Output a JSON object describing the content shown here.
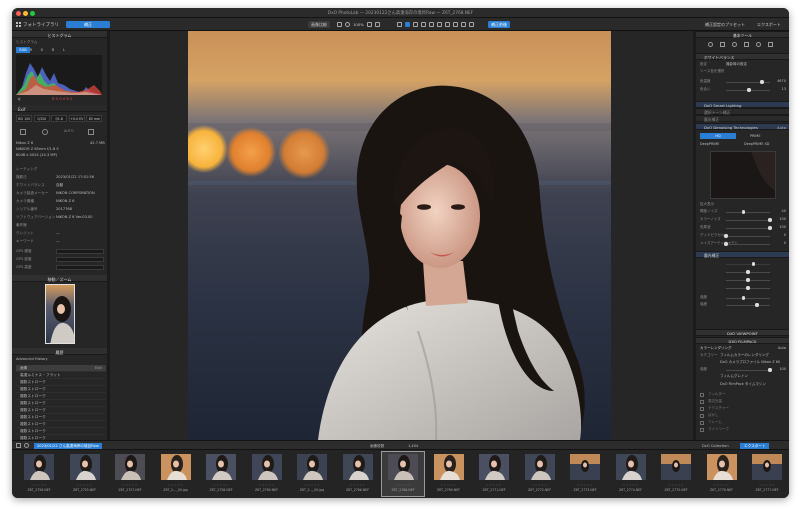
{
  "window": {
    "title": "DxO PhotoLab — 20230122さん高遠海岸の境目Raw — Z6T_2768.NEF"
  },
  "toolbar": {
    "photo_library_tab": "フォトライブラリ",
    "customize_tab": "補正",
    "compare_label": "画像比較",
    "zoom_label": "100%",
    "before_after_label": "補正前後",
    "preset_label": "補正設定のプリセット",
    "export_label": "エクスポート"
  },
  "left_panel": {
    "histogram_header": "ヒストグラム",
    "histogram_sub": "ヒストグラム",
    "channels": [
      "RGB",
      "R",
      "G",
      "B",
      "L"
    ],
    "histogram_values": "R 0  G 0  B 0",
    "exif_header": "Exif",
    "camera_settings": [
      "ISO 100",
      "1/320",
      "f/1.8",
      "+0.0 EV",
      "85 mm"
    ],
    "camera_model": "Nikon Z 6",
    "lens_model": "NIKKOR Z 85mm f/1.8 S",
    "file_size": "42.7 MB",
    "dimensions": "6048 x 4024 (24.3 MP)",
    "metadata": [
      {
        "k": "レーティング",
        "v": ""
      },
      {
        "k": "撮影日",
        "v": "2023/01/22 17:01:56"
      },
      {
        "k": "ホワイトバランス",
        "v": "自動"
      },
      {
        "k": "カメラ製造メーカー",
        "v": "NIKON CORPORATION"
      },
      {
        "k": "カメラ機種",
        "v": "NIKON Z 6"
      },
      {
        "k": "シリアル番号",
        "v": "2017768"
      },
      {
        "k": "ソフトウェアバージョン",
        "v": "NIKON Z 6 Ver.03.00"
      },
      {
        "k": "著作権",
        "v": ""
      },
      {
        "k": "クレジット",
        "v": "—"
      },
      {
        "k": "キーワード",
        "v": "—"
      }
    ],
    "gps_rows": [
      "GPS 緯度",
      "GPS 経度",
      "GPS 高度"
    ],
    "navigator_header": "移動／ズーム",
    "history_header": "履歴",
    "history_title": "Advanced History",
    "history_items": [
      "画像",
      "高遠ルミナス・フラット",
      "複数ストローク",
      "複数ストローク",
      "複数ストローク",
      "複数ストローク",
      "複数ストローク",
      "複数ストローク",
      "複数ストローク",
      "複数ストローク",
      "複数ストローク"
    ],
    "history_first_value": "Edit"
  },
  "right_panel": {
    "header": "基本ツール",
    "wb_header": "ホワイトバランス",
    "wb_mode": "撮影時の設定",
    "wb_sub": "ソース色を選択",
    "sliders_wb": [
      {
        "label": "色温度",
        "value": "4670",
        "pos": 0.82
      },
      {
        "label": "色合い",
        "value": "13",
        "pos": 0.52
      }
    ],
    "smart_lighting": "DxO Smart Lighting",
    "selective_tone": "選択トーン補正",
    "exposure": "露出補正",
    "denoising": "DxO Denoising Technologies",
    "denoise_modes": [
      "HQ",
      "PRIME",
      "DeepPRIME",
      "DeepPRIME XD"
    ],
    "denoise_value": "Auto",
    "denoise_sliders": [
      {
        "label": "輝度ノイズ",
        "value": "40",
        "pos": 0.4
      },
      {
        "label": "カラーノイズ",
        "value": "100",
        "pos": 1.0
      },
      {
        "label": "低周波",
        "value": "100",
        "pos": 1.0
      },
      {
        "label": "デッドピクセル",
        "value": "0",
        "pos": 0.0
      },
      {
        "label": "メイズアーティファクト",
        "value": "0",
        "pos": 0.0
      }
    ],
    "contrast_header": "露光補正",
    "viewpoint": "DXO VIEWPOINT",
    "filmpack": "DXO FILMPACK",
    "color_rendering": "カラーレンダリング",
    "category": "カテゴリー",
    "category_value": "フィルムカラーのレンダリング",
    "rendering_value": "DxO カメラプロファイル Nikon Z 6II",
    "strength_label": "強度",
    "strength_value": "100",
    "film_grain": "フィルムグレイン",
    "film_grain_value": "DxO FilmPack タイムマシン",
    "extra_items": [
      "フィルター",
      "周辺光量",
      "テクスチャー",
      "ぼかし",
      "フレーム",
      "ライトリーク"
    ]
  },
  "filmstrip": {
    "folder_path": "2023/01/22 さん高遠海岸の境目Raw",
    "image_count_label": "画像枚数",
    "image_count": "1,404",
    "collection_label": "DxO Collection",
    "export_label": "エクスポート",
    "thumbnails": [
      "Z6T_2756.NEF",
      "Z6T_2755.NEF",
      "Z6T_2757.NEF",
      "Z6T_2..._00.jpg",
      "Z6T_2758.NEF",
      "Z6T_2760.NEF",
      "Z6T_2..._00.jpg",
      "Z6T_2766.NEF",
      "Z6T_2768.NEF",
      "Z6T_2769.NEF",
      "Z6T_2771.NEF",
      "Z6T_2772.NEF",
      "Z6T_2773.NEF",
      "Z6T_2774.NEF",
      "Z6T_2775.NEF",
      "Z6T_2776.NEF",
      "Z6T_2777.NEF"
    ],
    "selected_index": 8
  },
  "colors": {
    "accent_blue": "#2a7fd4",
    "panel_bg": "#262626",
    "toolbar_bg": "#2a2a2a"
  }
}
